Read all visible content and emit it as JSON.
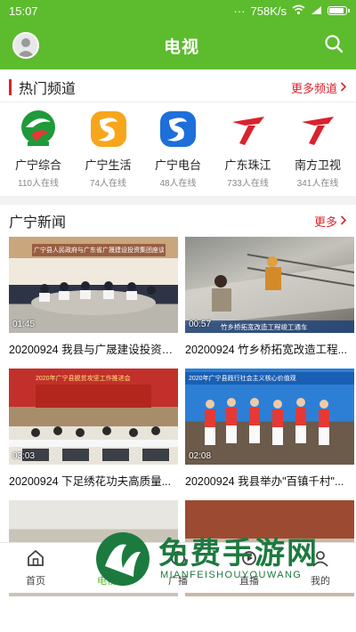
{
  "status": {
    "time": "15:07",
    "dots": "···",
    "speed": "758K/s"
  },
  "header": {
    "title": "电视"
  },
  "hot_channels": {
    "title": "热门频道",
    "more": "更多频道",
    "items": [
      {
        "name": "广宁综合",
        "online": "110人在线"
      },
      {
        "name": "广宁生活",
        "online": "74人在线"
      },
      {
        "name": "广宁电台",
        "online": "48人在线"
      },
      {
        "name": "广东珠江",
        "online": "733人在线"
      },
      {
        "name": "南方卫视",
        "online": "341人在线"
      }
    ]
  },
  "news": {
    "title": "广宁新闻",
    "more": "更多",
    "videos": [
      {
        "duration": "01:45",
        "title": "20200924 我县与广晟建设投资集团...",
        "banner": "广宁县人民政府与广东省广晟建设投资集团座谈会"
      },
      {
        "duration": "00:57",
        "title": "20200924 竹乡桥拓宽改造工程...",
        "caption": "竹乡桥拓宽改造工程竣工通车"
      },
      {
        "duration": "03:03",
        "title": "20200924 下足绣花功夫高质量...",
        "banner": "2020年广宁县脱贫攻坚工作推进会"
      },
      {
        "duration": "02:08",
        "title": "20200924 我县举办\"百镇千村\"...",
        "banner": "2020年广宁县践行社会主义核心价值观"
      }
    ]
  },
  "tabbar": {
    "items": [
      {
        "label": "首页"
      },
      {
        "label": "电视"
      },
      {
        "label": "广播"
      },
      {
        "label": "直播"
      },
      {
        "label": "我的"
      }
    ]
  },
  "watermark": {
    "text": "免费手游网",
    "sub": "MIANFEISHOUYOUWANG"
  },
  "colors": {
    "green": "#5dbb2e",
    "red": "#d9232d"
  }
}
